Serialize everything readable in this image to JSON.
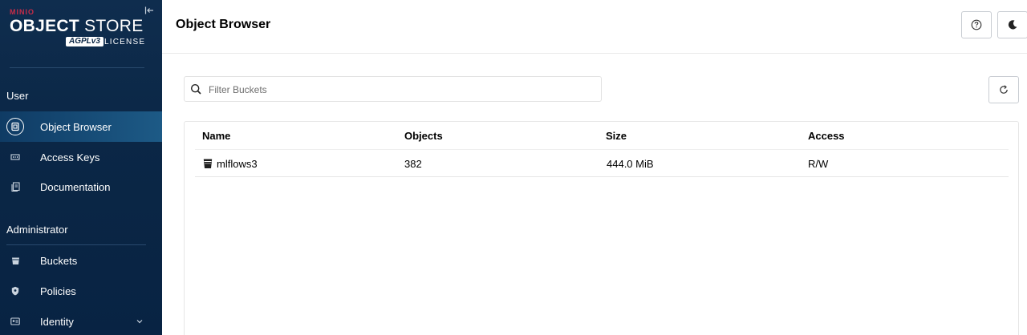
{
  "brand": {
    "minio": "MINIO",
    "object": "OBJECT",
    "store": " STORE",
    "agpl": "AGPLv3",
    "license": "LICENSE"
  },
  "sidebar": {
    "section_user": "User",
    "section_admin": "Administrator",
    "items": [
      {
        "label": "Object Browser",
        "icon": "object-browser-icon",
        "active": true
      },
      {
        "label": "Access Keys",
        "icon": "access-keys-icon"
      },
      {
        "label": "Documentation",
        "icon": "documentation-icon"
      },
      {
        "label": "Buckets",
        "icon": "bucket-icon"
      },
      {
        "label": "Policies",
        "icon": "policies-icon"
      },
      {
        "label": "Identity",
        "icon": "identity-icon",
        "expandable": true
      }
    ]
  },
  "header": {
    "title": "Object Browser",
    "help_icon": "help-icon",
    "theme_icon": "moon-icon"
  },
  "filter": {
    "placeholder": "Filter Buckets",
    "value": ""
  },
  "table": {
    "columns": [
      "Name",
      "Objects",
      "Size",
      "Access"
    ],
    "rows": [
      {
        "name": "mlflows3",
        "objects": "382",
        "size": "444.0 MiB",
        "access": "R/W"
      }
    ]
  },
  "colors": {
    "sidebar_bg": "#0b2746",
    "active_item": "#1d5a86",
    "brand_red": "#c72c48"
  }
}
